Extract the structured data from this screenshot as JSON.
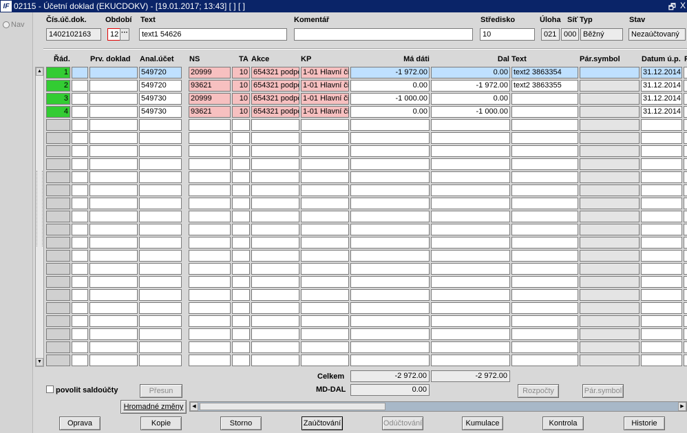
{
  "window": {
    "title": "02115 - Účetní doklad (EKUCDOKV) - [19.01.2017; 13:43]  [ ]  [ ]",
    "logo": "IF",
    "restore_glyph": "🗗",
    "close_glyph": "X"
  },
  "nav": {
    "label": "Nav"
  },
  "header": {
    "labels": {
      "cis": "Čís.úč.dok.",
      "obdobi": "Období",
      "text": "Text",
      "komentar": "Komentář",
      "stredisko": "Středisko",
      "uloha": "Úloha",
      "sit": "Síť",
      "typ": "Typ",
      "stav": "Stav"
    },
    "values": {
      "cis": "1402102163",
      "obdobi": "12",
      "text": "text1 54626",
      "komentar": "",
      "stredisko": "10",
      "uloha": "021",
      "sit": "000",
      "typ": "Běžný",
      "stav": "Nezaúčtovaný"
    },
    "dots": "···"
  },
  "columns": {
    "rad": "Řád.",
    "prv": "Prv. doklad",
    "anal": "Anal.účet",
    "ns": "NS",
    "ta": "TA",
    "akce": "Akce",
    "kp": "KP",
    "md": "Má dáti",
    "dal": "Dal",
    "text": "Text",
    "par": "Pár.symbol",
    "datum": "Datum ú.p.",
    "extra": "F"
  },
  "rows": [
    {
      "rad": "1",
      "anal": "549720",
      "ns": "20999",
      "ta": "10",
      "akce": "654321 podpora",
      "kp": "1-01 Hlavní činnost",
      "md": "-1 972.00",
      "dal": "0.00",
      "text": "text2 3863354",
      "datum": "31.12.2014"
    },
    {
      "rad": "2",
      "anal": "549720",
      "ns": "93621",
      "ta": "10",
      "akce": "654321 podpora",
      "kp": "1-01 Hlavní činnost",
      "md": "0.00",
      "dal": "-1 972.00",
      "text": "text2 3863355",
      "datum": "31.12.2014"
    },
    {
      "rad": "3",
      "anal": "549730",
      "ns": "20999",
      "ta": "10",
      "akce": "654321 podpora",
      "kp": "1-01 Hlavní činnost",
      "md": "-1 000.00",
      "dal": "0.00",
      "text": "",
      "datum": "31.12.2014"
    },
    {
      "rad": "4",
      "anal": "549730",
      "ns": "93621",
      "ta": "10",
      "akce": "654321 podpora",
      "kp": "1-01 Hlavní činnost",
      "md": "0.00",
      "dal": "-1 000.00",
      "text": "",
      "datum": "31.12.2014"
    }
  ],
  "totals": {
    "celkem_label": "Celkem",
    "celkem_md": "-2 972.00",
    "celkem_dal": "-2 972.00",
    "mddal_label": "MD-DAL",
    "mddal_value": "0.00"
  },
  "controls": {
    "saldo_label": "povolit saldoúčty",
    "presun": "Přesun",
    "rozpocty": "Rozpočty",
    "parsymbol": "Pár.symbol",
    "hromadne": "Hromadné změny"
  },
  "buttons": [
    "Oprava",
    "Kopie",
    "Storno",
    "Zaúčtování",
    "Odúčtování",
    "Kumulace",
    "Kontrola",
    "Historie"
  ],
  "colors": {
    "titlebar": "#0a2468",
    "row_marker": "#33cc33",
    "pink": "#f7c0c0",
    "selected": "#bfe0ff"
  }
}
